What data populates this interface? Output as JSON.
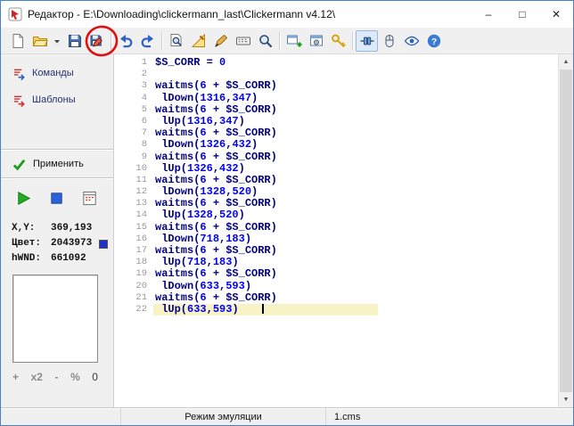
{
  "window": {
    "title": "Редактор - E:\\Downloading\\clickermann_last\\Clickermann v4.12\\",
    "controls": {
      "minimize": "–",
      "maximize": "□",
      "close": "✕"
    }
  },
  "toolbar": {
    "icons": [
      {
        "name": "new-file-icon"
      },
      {
        "name": "open-file-icon"
      },
      {
        "name": "open-dropdown-icon",
        "narrow": true
      },
      {
        "name": "save-icon"
      },
      {
        "name": "save-as-icon",
        "annotated": true
      },
      {
        "name": "undo-icon"
      },
      {
        "name": "redo-icon"
      },
      {
        "name": "find-icon"
      },
      {
        "name": "edit-ruler-icon"
      },
      {
        "name": "pen-icon"
      },
      {
        "name": "keyboard-icon"
      },
      {
        "name": "zoom-icon"
      },
      {
        "name": "add-window-icon"
      },
      {
        "name": "window-settings-icon"
      },
      {
        "name": "key-search-icon"
      },
      {
        "name": "emulation-toggle-icon",
        "pressed": true
      },
      {
        "name": "mouse-icon"
      },
      {
        "name": "eye-icon"
      },
      {
        "name": "help-icon"
      }
    ],
    "annotation": {
      "type": "red-circle",
      "target": "save-as-icon",
      "color": "#E01010"
    }
  },
  "sidebar": {
    "commands_label": "Команды",
    "templates_label": "Шаблоны",
    "apply_label": "Применить",
    "xy_label": "X,Y:",
    "xy_value": "369,193",
    "color_label": "Цвет:",
    "color_value": "2043973",
    "swatch_style": "background:#1F30C5",
    "hwnd_label": "hWND:",
    "hwnd_value": "661092",
    "zoom_controls": [
      "+",
      "x2",
      "-",
      "%",
      "0"
    ]
  },
  "editor": {
    "current_line": 22,
    "colors": {
      "function": "#000080",
      "number": "#0000FF",
      "current_line_bg": "#F7F3C6"
    },
    "lines": [
      "$S_CORR = 0",
      "",
      "waitms(6 + $S_CORR)",
      " lDown(1316,347)",
      "waitms(6 + $S_CORR)",
      " lUp(1316,347)",
      "waitms(6 + $S_CORR)",
      " lDown(1326,432)",
      "waitms(6 + $S_CORR)",
      " lUp(1326,432)",
      "waitms(6 + $S_CORR)",
      " lDown(1328,520)",
      "waitms(6 + $S_CORR)",
      " lUp(1328,520)",
      "waitms(6 + $S_CORR)",
      " lDown(718,183)",
      "waitms(6 + $S_CORR)",
      " lUp(718,183)",
      "waitms(6 + $S_CORR)",
      " lDown(633,593)",
      "waitms(6 + $S_CORR)",
      " lUp(633,593)"
    ]
  },
  "statusbar": {
    "mode": "Режим эмуляции",
    "file": "1.cms"
  }
}
